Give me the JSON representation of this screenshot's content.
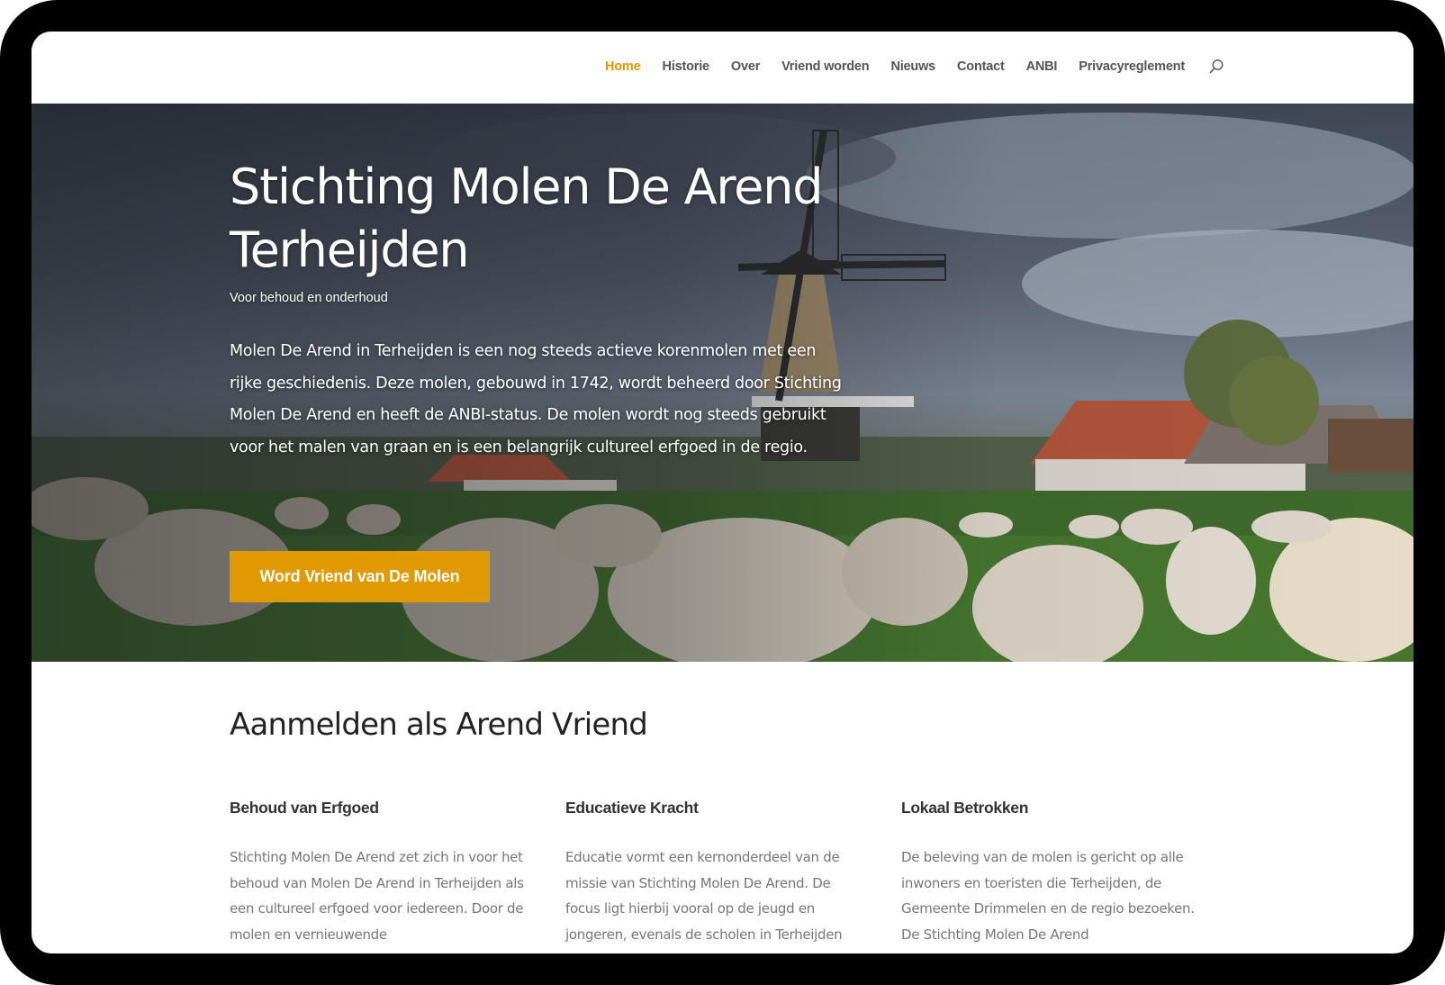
{
  "nav": {
    "items": [
      {
        "label": "Home",
        "active": true
      },
      {
        "label": "Historie",
        "active": false
      },
      {
        "label": "Over",
        "active": false
      },
      {
        "label": "Vriend worden",
        "active": false
      },
      {
        "label": "Nieuws",
        "active": false
      },
      {
        "label": "Contact",
        "active": false
      },
      {
        "label": "ANBI",
        "active": false
      },
      {
        "label": "Privacyreglement",
        "active": false
      }
    ],
    "search_icon": "search-icon"
  },
  "hero": {
    "title_line1": "Stichting Molen De Arend",
    "title_line2": "Terheijden",
    "subtitle": "Voor behoud en onderhoud",
    "text": "Molen De Arend in Terheijden is een nog steeds actieve korenmolen met een rijke geschiedenis. Deze molen, gebouwd in 1742, wordt beheerd door Stichting Molen De Arend en heeft de ANBI-status. De molen wordt nog steeds gebruikt voor het malen van graan en is een belangrijk cultureel erfgoed in de regio.",
    "cta_label": "Word Vriend van De Molen"
  },
  "section": {
    "title": "Aanmelden als Arend Vriend",
    "columns": [
      {
        "heading": "Behoud van Erfgoed",
        "text": "Stichting Molen De Arend zet zich in voor het behoud van Molen De Arend in Terheijden als een cultureel erfgoed voor iedereen. Door de molen en vernieuwende"
      },
      {
        "heading": "Educatieve Kracht",
        "text": "Educatie vormt een kernonderdeel van de missie van Stichting Molen De Arend. De focus ligt hierbij vooral op de jeugd en jongeren, evenals de scholen in Terheijden"
      },
      {
        "heading": "Lokaal Betrokken",
        "text": "De beleving van de molen is gericht op alle inwoners en toeristen die Terheijden, de Gemeente Drimmelen en de regio bezoeken. De Stichting Molen De Arend"
      }
    ]
  },
  "colors": {
    "accent": "#e09900",
    "nav_text": "#555555",
    "heading": "#333333",
    "body_text": "#777777"
  }
}
